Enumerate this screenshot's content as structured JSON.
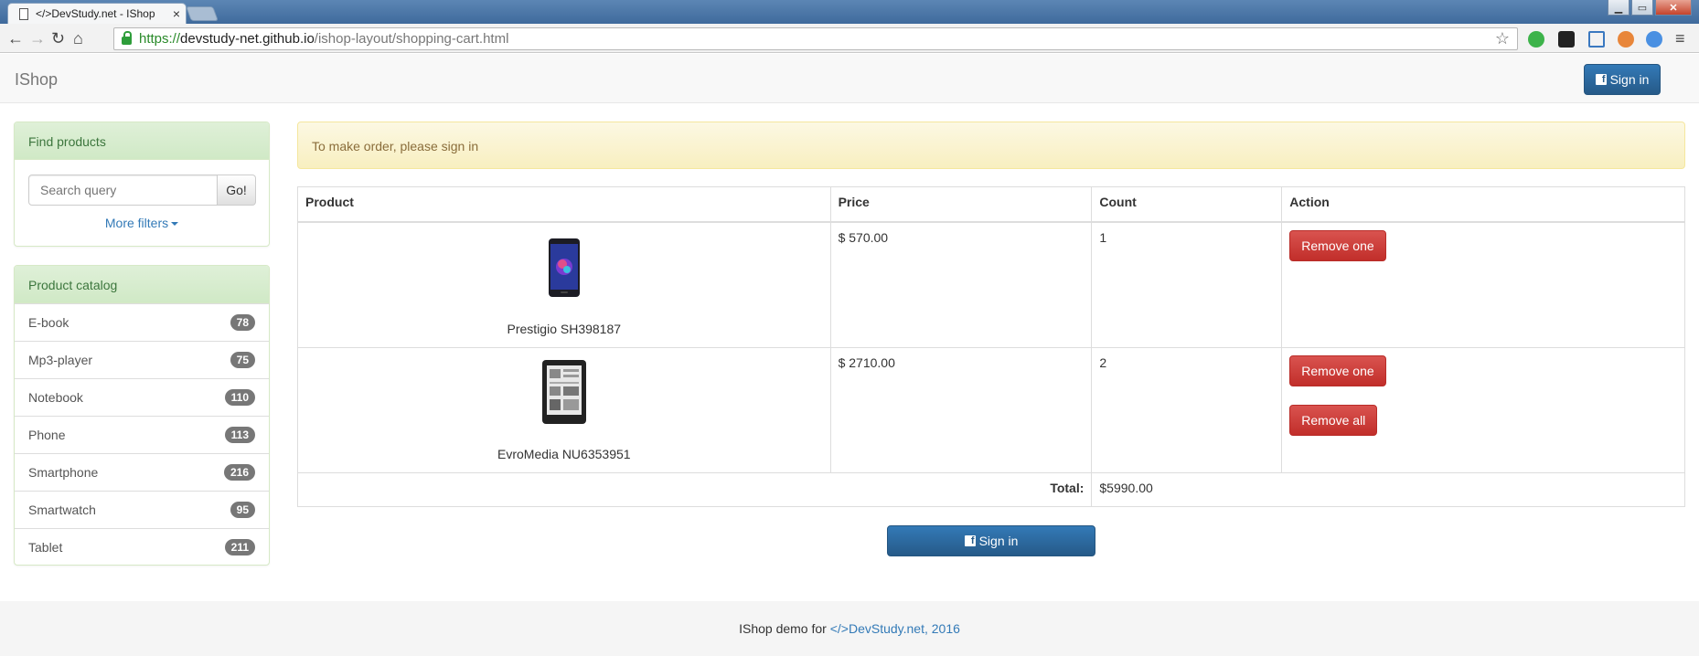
{
  "browser": {
    "tab_title": "</>DevStudy.net - IShop",
    "tab_close": "×",
    "url_https": "https://",
    "url_host": "devstudy-net.github.io",
    "url_path": "/ishop-layout/shopping-cart.html"
  },
  "navbar": {
    "brand": "IShop",
    "signin_label": "Sign in"
  },
  "sidebar": {
    "find_title": "Find products",
    "search_placeholder": "Search query",
    "go_label": "Go!",
    "more_filters": "More filters",
    "catalog_title": "Product catalog",
    "categories": [
      {
        "name": "E-book",
        "count": "78"
      },
      {
        "name": "Mp3-player",
        "count": "75"
      },
      {
        "name": "Notebook",
        "count": "110"
      },
      {
        "name": "Phone",
        "count": "113"
      },
      {
        "name": "Smartphone",
        "count": "216"
      },
      {
        "name": "Smartwatch",
        "count": "95"
      },
      {
        "name": "Tablet",
        "count": "211"
      }
    ]
  },
  "alert": "To make order, please sign in",
  "cart": {
    "headers": [
      "Product",
      "Price",
      "Count",
      "Action"
    ],
    "items": [
      {
        "name": "Prestigio SH398187",
        "price": "$ 570.00",
        "count": "1"
      },
      {
        "name": "EvroMedia NU6353951",
        "price": "$ 2710.00",
        "count": "2"
      }
    ],
    "remove_one": "Remove one",
    "remove_all": "Remove all",
    "total_label": "Total:",
    "total_value": "$5990.00",
    "signin_label": "Sign in"
  },
  "footer": {
    "text": "IShop demo for",
    "link": "</>DevStudy.net, 2016"
  },
  "colors": {
    "primary": "#337ab7",
    "danger": "#d9534f",
    "panel_success": "#dff0d8",
    "alert_warning": "#fcf8e3"
  }
}
